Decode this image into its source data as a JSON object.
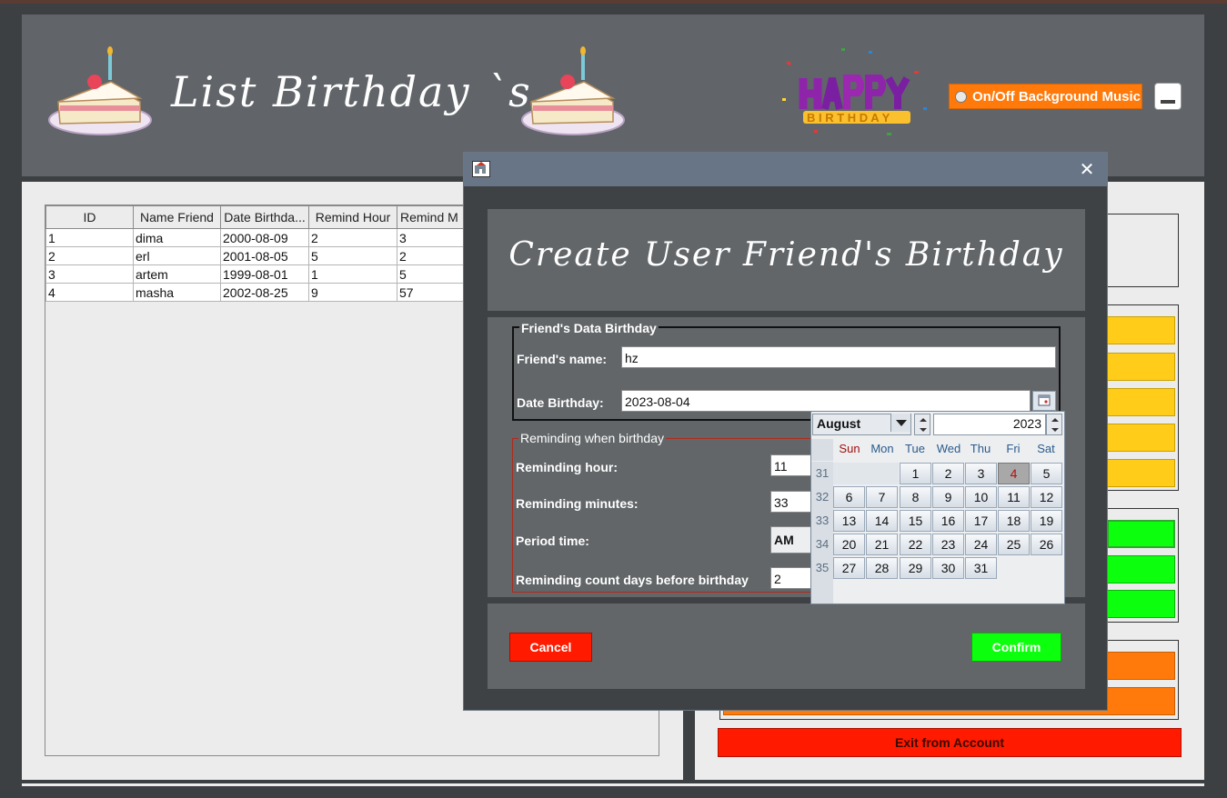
{
  "header": {
    "title": "List Birthday `s",
    "music_toggle_label": "On/Off Background Music"
  },
  "table": {
    "columns": [
      "ID",
      "Name Friend",
      "Date Birthda...",
      "Remind Hour",
      "Remind M"
    ],
    "rows": [
      [
        "1",
        "dima",
        "2000-08-09",
        "2",
        "3"
      ],
      [
        "2",
        "erl",
        "2001-08-05",
        "5",
        "2"
      ],
      [
        "3",
        "artem",
        "1999-08-01",
        "1",
        "5"
      ],
      [
        "4",
        "masha",
        "2002-08-25",
        "9",
        "57"
      ]
    ]
  },
  "right_panel": {
    "exit_label": "Exit from Account"
  },
  "dialog": {
    "heading": "Create User Friend's Birthday",
    "group1_legend": "Friend's Data Birthday",
    "name_label": "Friend's name:",
    "name_value": "hz",
    "date_label": "Date Birthday:",
    "date_value": "2023-08-04",
    "group2_legend": "Reminding when birthday",
    "hour_label": "Reminding hour:",
    "hour_value": "11",
    "minutes_label": "Reminding minutes:",
    "minutes_value": "33",
    "period_label": "Period time:",
    "period_value": "AM",
    "days_label": "Reminding count days before birthday",
    "days_value": "2",
    "cancel_label": "Cancel",
    "confirm_label": "Confirm"
  },
  "calendar": {
    "month": "August",
    "year": "2023",
    "weekdays": [
      "Sun",
      "Mon",
      "Tue",
      "Wed",
      "Thu",
      "Fri",
      "Sat"
    ],
    "weeks": [
      "31",
      "32",
      "33",
      "34",
      "35"
    ],
    "days": [
      "1",
      "2",
      "3",
      "4",
      "5",
      "6",
      "7",
      "8",
      "9",
      "10",
      "11",
      "12",
      "13",
      "14",
      "15",
      "16",
      "17",
      "18",
      "19",
      "20",
      "21",
      "22",
      "23",
      "24",
      "25",
      "26",
      "27",
      "28",
      "29",
      "30",
      "31"
    ],
    "selected_day": "4"
  },
  "colors": {
    "orange": "#ff7a0a",
    "yellow": "#ffcc1a",
    "green": "#0cff0c",
    "red": "#ff1a00"
  }
}
